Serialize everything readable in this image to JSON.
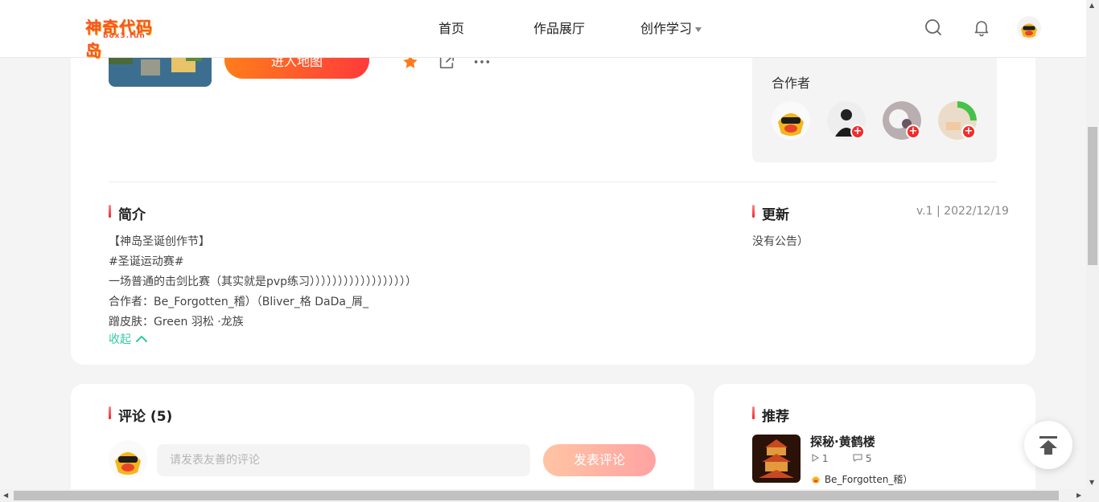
{
  "nav": {
    "logo_text": "神奇代码岛",
    "logo_sub": "box3.fun",
    "home": "首页",
    "gallery": "作品展厅",
    "learn": "创作学习"
  },
  "work": {
    "enter_button": "进入地图"
  },
  "collaborators": {
    "title": "合作者"
  },
  "intro": {
    "title": "简介",
    "lines": [
      "【神岛圣诞创作节】",
      "#圣诞运动赛#",
      "一场普通的击剑比赛（其实就是pvp练习））））））））））））））））））",
      "合作者：Be_Forgotten_稽）（Bliver_格 DaDa_屑_",
      "蹭皮肤：Green 羽松 ·龙族"
    ],
    "collapse": "收起"
  },
  "update": {
    "title": "更新",
    "version": "v.1 | 2022/12/19",
    "notice": "没有公告）"
  },
  "comments": {
    "title": "评论 (5)",
    "placeholder": "请发表友善的评论",
    "post_button": "发表评论"
  },
  "recommend": {
    "title": "推荐",
    "item": {
      "title": "探秘·黄鹤楼",
      "plays": "1",
      "comments": "5",
      "author": "Be_Forgotten_稽）"
    }
  },
  "colors": {
    "accent_orange": "#ff7d1a",
    "accent_red": "#ff3b3b",
    "link_green": "#35c6a8"
  }
}
